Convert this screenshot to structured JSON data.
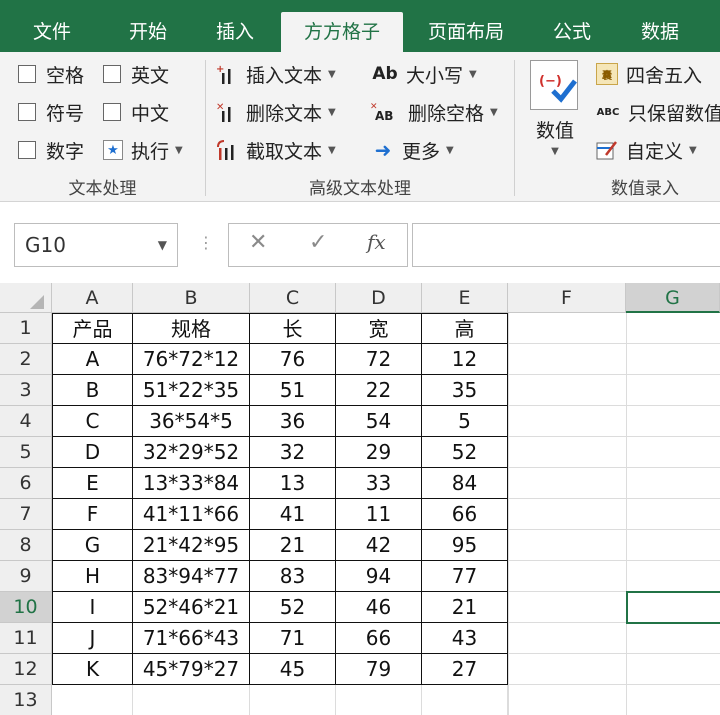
{
  "tabs": [
    {
      "label": "文件",
      "active": false
    },
    {
      "label": "开始",
      "active": false
    },
    {
      "label": "插入",
      "active": false
    },
    {
      "label": "方方格子",
      "active": true
    },
    {
      "label": "页面布局",
      "active": false
    },
    {
      "label": "公式",
      "active": false
    },
    {
      "label": "数据",
      "active": false
    }
  ],
  "ribbon": {
    "text_processing": {
      "checkboxes": [
        "空格",
        "英文",
        "符号",
        "中文",
        "数字"
      ],
      "execute": "执行",
      "group_label": "文本处理"
    },
    "advanced_text": {
      "insert_text": "插入文本",
      "delete_text": "删除文本",
      "extract_text": "截取文本",
      "case": "大小写",
      "case_icon": "Ab",
      "delete_spaces": "删除空格",
      "more": "更多",
      "group_label": "高级文本处理"
    },
    "numeric_entry": {
      "numeric": "数值",
      "round": "四舍五入",
      "keep_numeric": "只保留数值",
      "custom": "自定义",
      "group_label": "数值录入"
    }
  },
  "formula_bar": {
    "name_box": "G10",
    "cancel_symbol": "✕",
    "confirm_symbol": "✓",
    "fx_symbol": "fx",
    "formula": ""
  },
  "sheet": {
    "columns": [
      "A",
      "B",
      "C",
      "D",
      "E",
      "F",
      "G"
    ],
    "selected_column": "G",
    "selected_row": "10",
    "rows": [
      {
        "num": "1",
        "cells": [
          "产品",
          "规格",
          "长",
          "宽",
          "高"
        ]
      },
      {
        "num": "2",
        "cells": [
          "A",
          "76*72*12",
          "76",
          "72",
          "12"
        ]
      },
      {
        "num": "3",
        "cells": [
          "B",
          "51*22*35",
          "51",
          "22",
          "35"
        ]
      },
      {
        "num": "4",
        "cells": [
          "C",
          "36*54*5",
          "36",
          "54",
          "5"
        ]
      },
      {
        "num": "5",
        "cells": [
          "D",
          "32*29*52",
          "32",
          "29",
          "52"
        ]
      },
      {
        "num": "6",
        "cells": [
          "E",
          "13*33*84",
          "13",
          "33",
          "84"
        ]
      },
      {
        "num": "7",
        "cells": [
          "F",
          "41*11*66",
          "41",
          "11",
          "66"
        ]
      },
      {
        "num": "8",
        "cells": [
          "G",
          "21*42*95",
          "21",
          "42",
          "95"
        ]
      },
      {
        "num": "9",
        "cells": [
          "H",
          "83*94*77",
          "83",
          "94",
          "77"
        ]
      },
      {
        "num": "10",
        "cells": [
          "I",
          "52*46*21",
          "52",
          "46",
          "21"
        ]
      },
      {
        "num": "11",
        "cells": [
          "J",
          "71*66*43",
          "71",
          "66",
          "43"
        ]
      },
      {
        "num": "12",
        "cells": [
          "K",
          "45*79*27",
          "45",
          "79",
          "27"
        ]
      },
      {
        "num": "13",
        "cells": [
          "",
          "",
          "",
          "",
          ""
        ]
      }
    ]
  },
  "colors": {
    "accent": "#217346"
  }
}
